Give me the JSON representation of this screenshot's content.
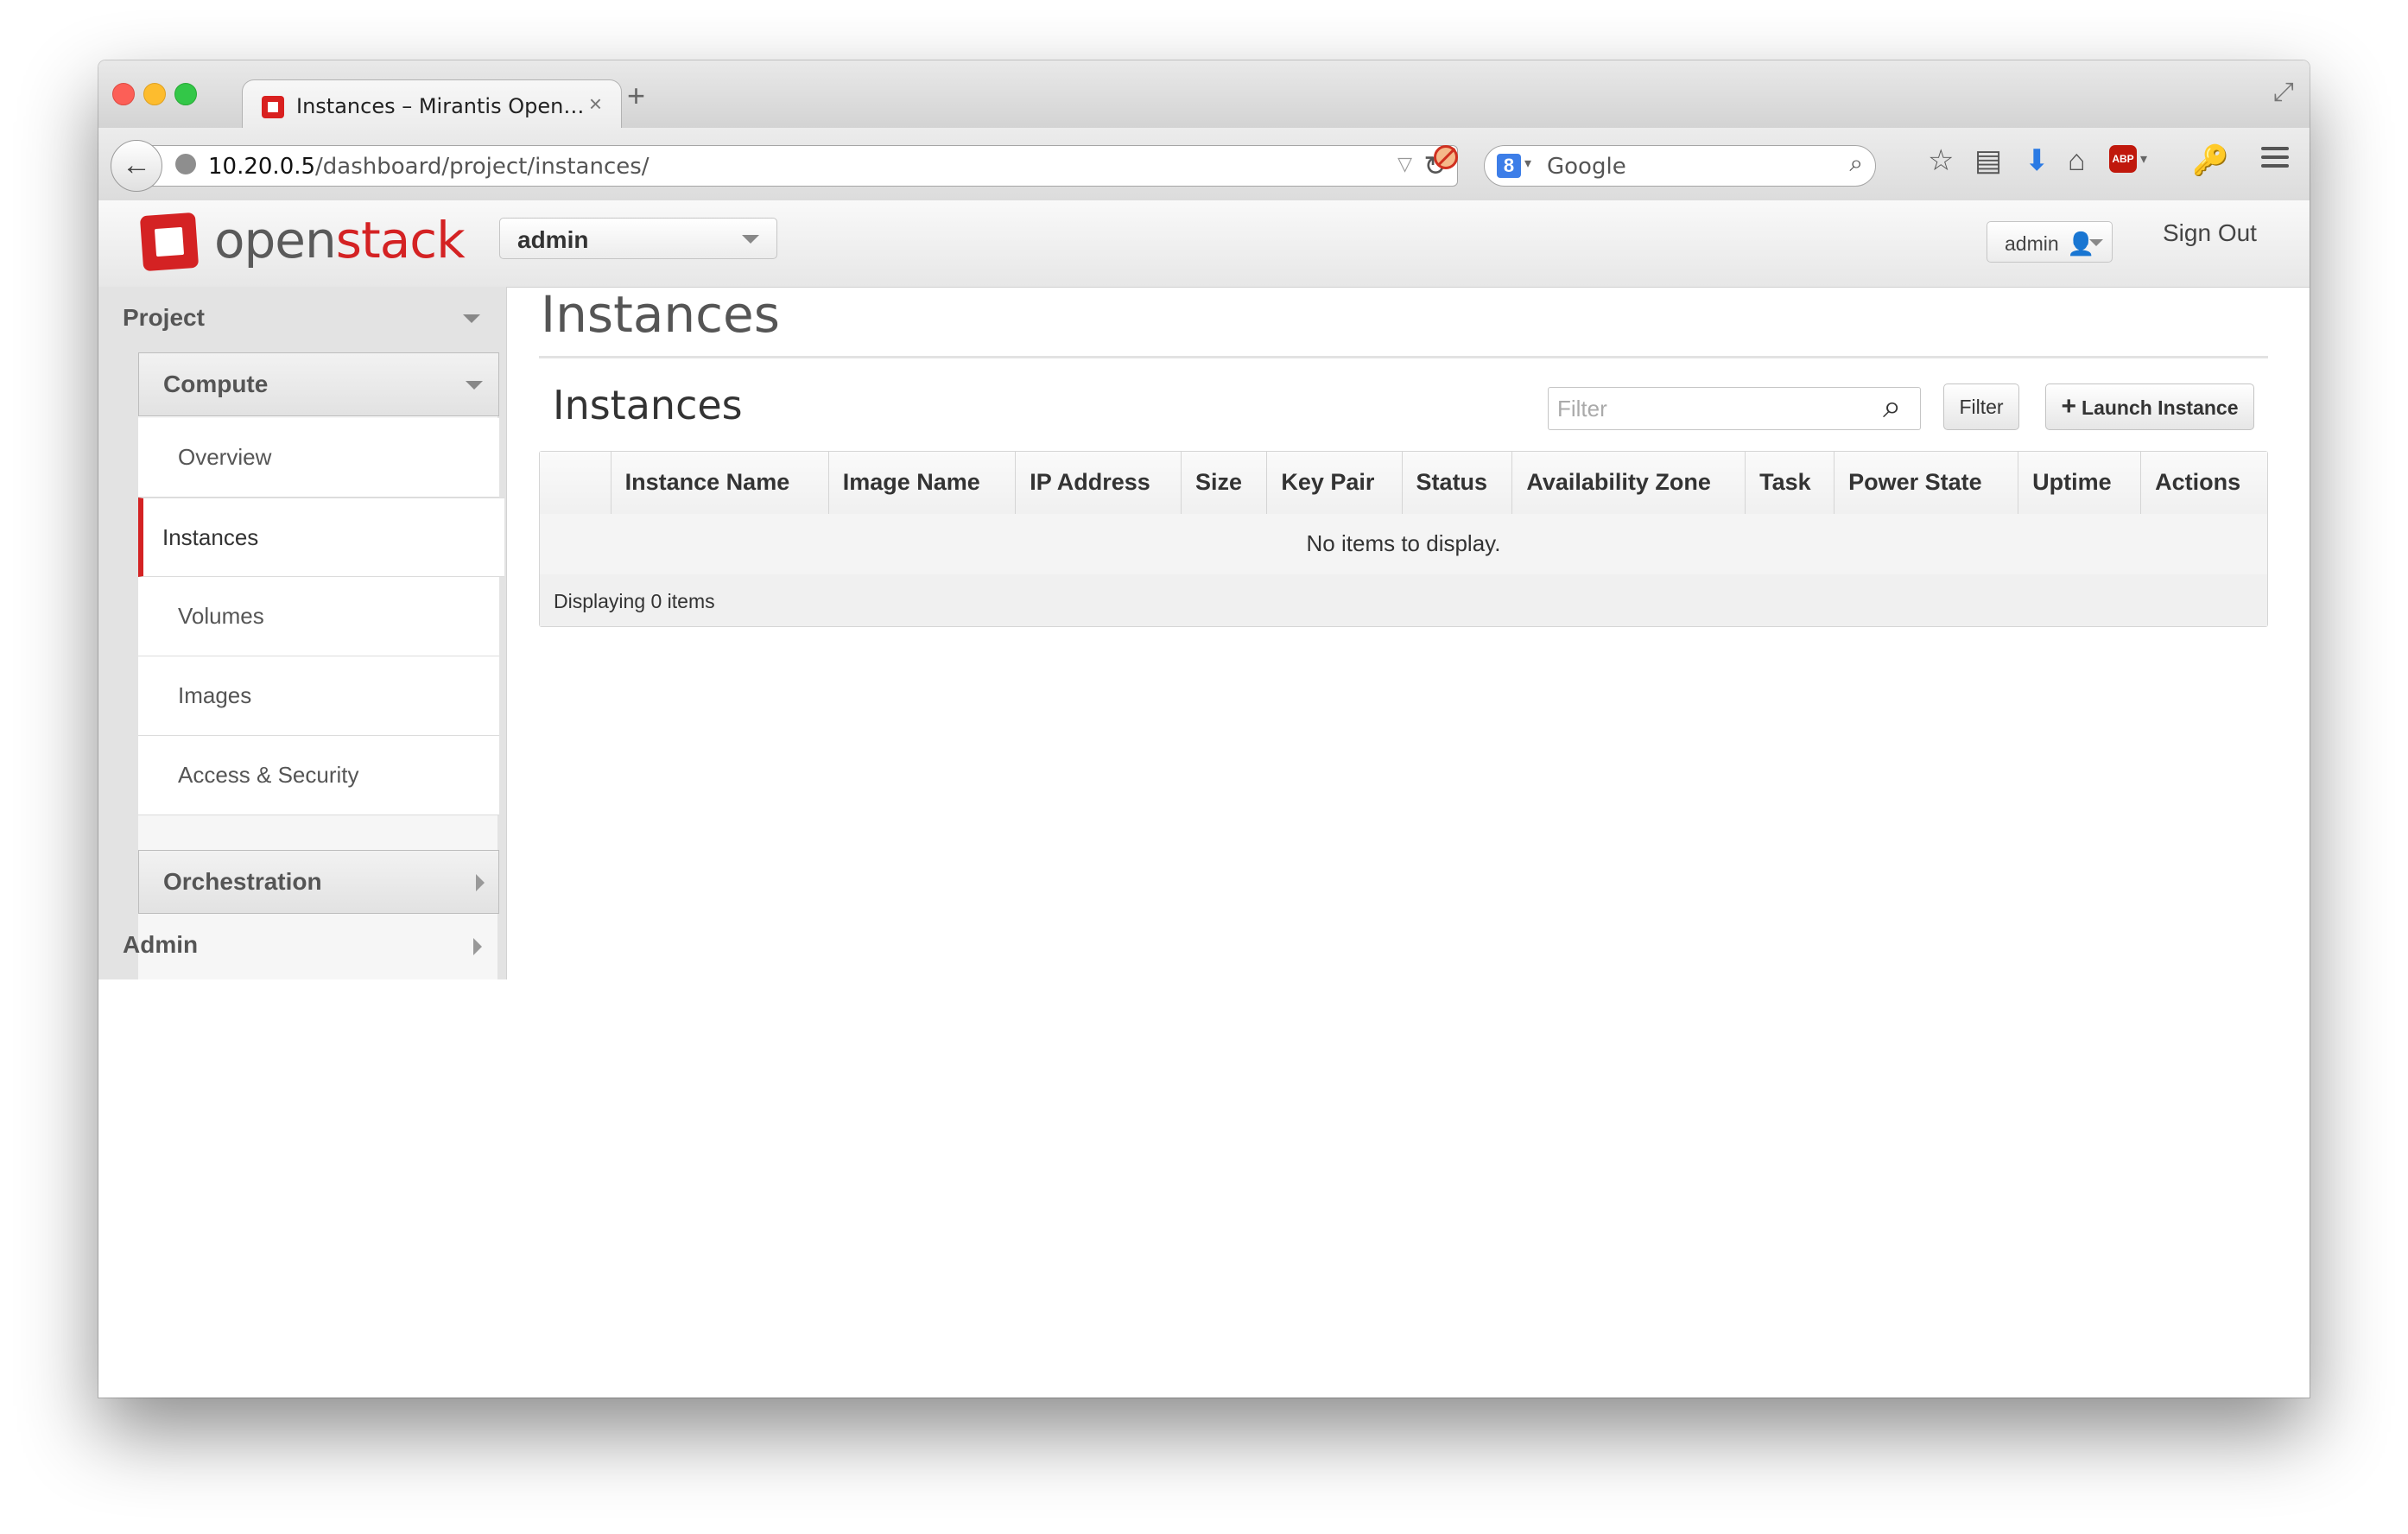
{
  "browser": {
    "tab_title": "Instances – Mirantis Open…",
    "tab_close": "×",
    "new_tab": "+",
    "url_host": "10.20.0.5",
    "url_path": "/dashboard/project/instances/",
    "search_engine_icon": "8",
    "search_placeholder": "Google"
  },
  "header": {
    "logo_open": "open",
    "logo_stack": "stack",
    "project": "admin",
    "user": "admin",
    "sign_out": "Sign Out"
  },
  "sidebar": {
    "project": "Project",
    "compute": "Compute",
    "items": [
      "Overview",
      "Instances",
      "Volumes",
      "Images",
      "Access & Security"
    ],
    "orchestration": "Orchestration",
    "admin": "Admin"
  },
  "main": {
    "page_title": "Instances",
    "table_title": "Instances",
    "filter_placeholder": "Filter",
    "filter_button": "Filter",
    "launch_button": "Launch Instance",
    "columns": [
      "Instance Name",
      "Image Name",
      "IP Address",
      "Size",
      "Key Pair",
      "Status",
      "Availability Zone",
      "Task",
      "Power State",
      "Uptime",
      "Actions"
    ],
    "empty_message": "No items to display.",
    "footer": "Displaying 0 items"
  },
  "colors": {
    "accent": "#d42223",
    "download_icon": "#2a7ae4"
  }
}
